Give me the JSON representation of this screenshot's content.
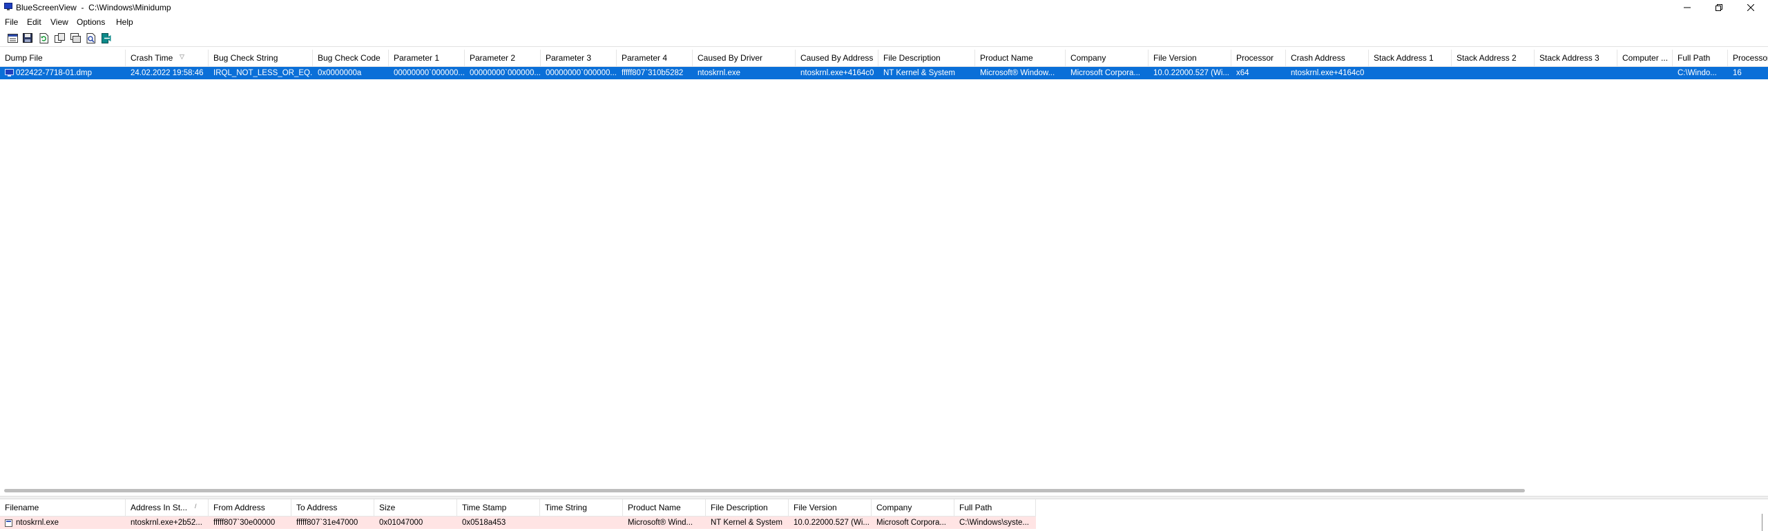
{
  "window": {
    "app_name": "BlueScreenView",
    "title": "BlueScreenView  -  C:\\Windows\\Minidump"
  },
  "menu": [
    "File",
    "Edit",
    "View",
    "Options",
    "Help"
  ],
  "toolbar_icons": [
    "properties-icon",
    "save-icon",
    "refresh-icon",
    "copy-icon",
    "html-report-icon",
    "find-icon",
    "exit-icon"
  ],
  "dumps_table": {
    "columns": [
      "Dump File",
      "Crash Time",
      "Bug Check String",
      "Bug Check Code",
      "Parameter 1",
      "Parameter 2",
      "Parameter 3",
      "Parameter 4",
      "Caused By Driver",
      "Caused By Address",
      "File Description",
      "Product Name",
      "Company",
      "File Version",
      "Processor",
      "Crash Address",
      "Stack Address 1",
      "Stack Address 2",
      "Stack Address 3",
      "Computer ...",
      "Full Path",
      "Processors"
    ],
    "sorted_column": "Crash Time",
    "rows": [
      {
        "selected": true,
        "cells": [
          "022422-7718-01.dmp",
          "24.02.2022 19:58:46",
          "IRQL_NOT_LESS_OR_EQ...",
          "0x0000000a",
          "00000000`000000...",
          "00000000`000000...",
          "00000000`000000...",
          "fffff807`310b5282",
          "ntoskrnl.exe",
          "ntoskrnl.exe+4164c0",
          "NT Kernel & System",
          "Microsoft® Window...",
          "Microsoft Corpora...",
          "10.0.22000.527 (Wi...",
          "x64",
          "ntoskrnl.exe+4164c0",
          "",
          "",
          "",
          "",
          "C:\\Windo...",
          "16"
        ]
      }
    ]
  },
  "drivers_table": {
    "columns": [
      "Filename",
      "Address In St...",
      "From Address",
      "To Address",
      "Size",
      "Time Stamp",
      "Time String",
      "Product Name",
      "File Description",
      "File Version",
      "Company",
      "Full Path"
    ],
    "sorted_column": "Address In St...",
    "rows": [
      {
        "highlighted": true,
        "cells": [
          "ntoskrnl.exe",
          "ntoskrnl.exe+2b52...",
          "fffff807`30e00000",
          "fffff807`31e47000",
          "0x01047000",
          "0x0518a453",
          "",
          "Microsoft® Wind...",
          "NT Kernel & System",
          "10.0.22000.527 (Wi...",
          "Microsoft Corpora...",
          "C:\\Windows\\syste..."
        ]
      }
    ]
  },
  "colors": {
    "selection": "#0a6fd8",
    "highlight_row": "#ffe4e4"
  }
}
